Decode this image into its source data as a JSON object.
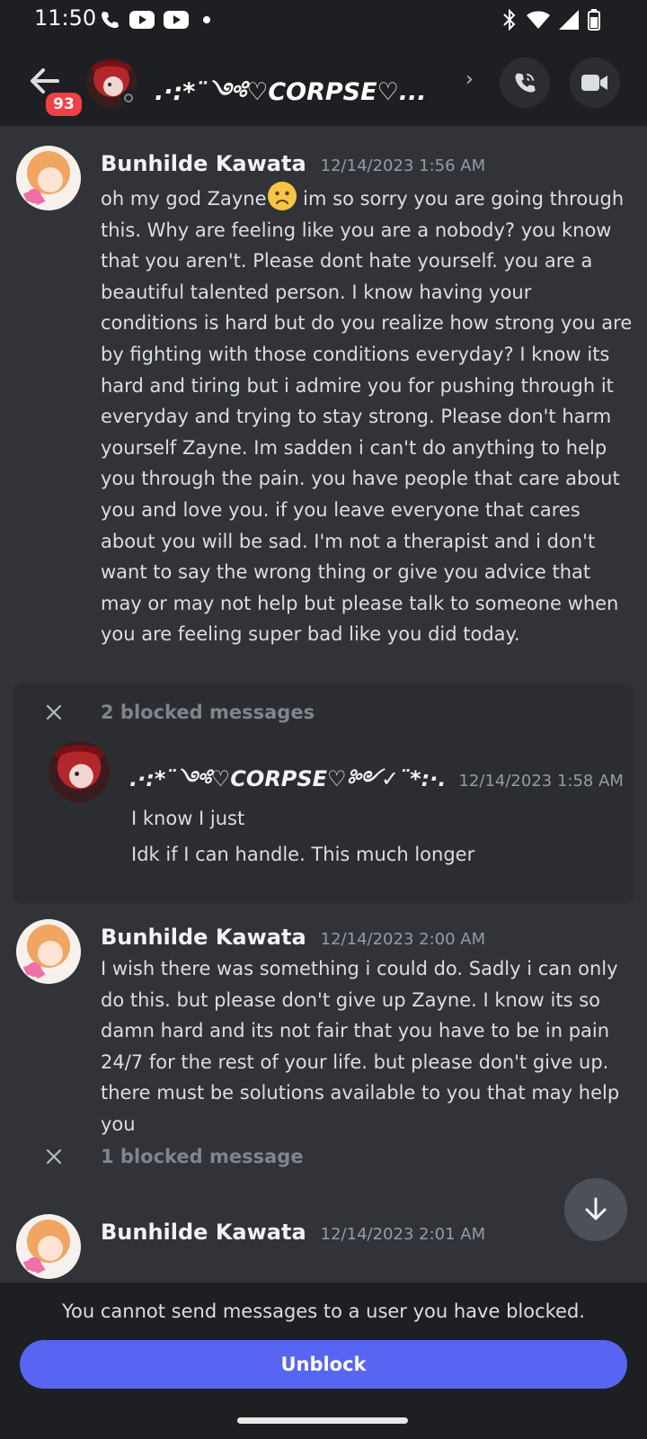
{
  "status_bar": {
    "time": "11:50"
  },
  "header": {
    "unread_count": "93",
    "channel_name": ".·:*¨༺♡CORPSE♡...",
    "avatar_icon": "user-avatar-icon"
  },
  "messages": [
    {
      "author": "Bunhilde Kawata",
      "timestamp": "12/14/2023 1:56 AM",
      "text_before_emoji": "oh my god Zayne",
      "emoji": "frowning-face-icon",
      "text_after_emoji": " im so sorry you are going through this. Why are feeling like you are a nobody? you know that you aren't. Please dont hate yourself. you are a beautiful talented person. I know having your conditions is hard but do you realize how strong you are by fighting with those conditions everyday? I know its hard and tiring but i admire you for pushing through it everyday and trying to stay strong. Please don't harm yourself Zayne. Im sadden i can't do anything to help you through the pain. you have people that care about you and love you. if you leave everyone that cares about you will be sad. I'm not a therapist and i don't want to say the wrong thing or give you advice that may or may not help but please talk to someone when you are feeling super bad like you did today."
    },
    {
      "author": "Bunhilde Kawata",
      "timestamp": "12/14/2023 2:00 AM",
      "text": "I wish there was something i could do. Sadly i can only do this. but please don't give up Zayne. I know its so damn hard and its not fair that you have to be in pain 24/7 for the rest of your life. but please don't give up. there must be solutions available to you that may help you"
    },
    {
      "author": "Bunhilde Kawata",
      "timestamp": "12/14/2023 2:01 AM"
    }
  ],
  "blocked_group_1": {
    "label": "2 blocked messages",
    "author": ".·:*¨༺♡CORPSE♡༻✓¨*:·.",
    "timestamp": "12/14/2023 1:58 AM",
    "lines": [
      "I know I just",
      "Idk if I can handle. This much longer"
    ]
  },
  "blocked_group_2": {
    "label": "1 blocked message"
  },
  "footer": {
    "notice": "You cannot send messages to a user you have blocked.",
    "unblock_label": "Unblock"
  },
  "colors": {
    "accent": "#5865f2",
    "badge": "#f23f43",
    "background": "#313338"
  }
}
